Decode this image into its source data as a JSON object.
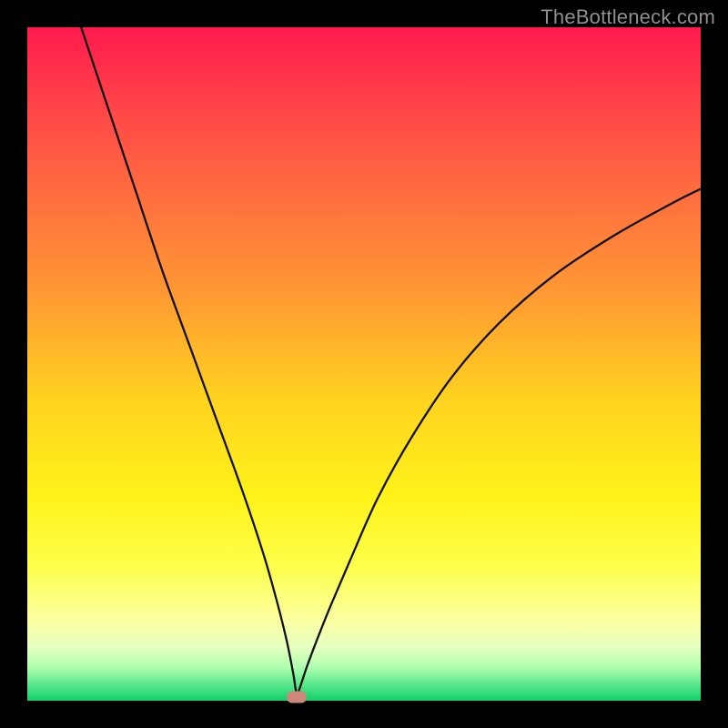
{
  "watermark": "TheBottleneck.com",
  "colors": {
    "frame": "#000000",
    "curve": "#111111",
    "marker": "#cf877c",
    "gradient_stops": [
      {
        "pos": 0.0,
        "hex": "#ff1a4d"
      },
      {
        "pos": 0.1,
        "hex": "#ff3e49"
      },
      {
        "pos": 0.25,
        "hex": "#ff6e3f"
      },
      {
        "pos": 0.4,
        "hex": "#ff9a33"
      },
      {
        "pos": 0.55,
        "hex": "#ffd21f"
      },
      {
        "pos": 0.7,
        "hex": "#fff31a"
      },
      {
        "pos": 0.8,
        "hex": "#fdff4a"
      },
      {
        "pos": 0.88,
        "hex": "#fbffa0"
      },
      {
        "pos": 0.92,
        "hex": "#e6ffc0"
      },
      {
        "pos": 0.95,
        "hex": "#b0ffb0"
      },
      {
        "pos": 0.98,
        "hex": "#4de385"
      },
      {
        "pos": 1.0,
        "hex": "#11d069"
      }
    ]
  },
  "chart_data": {
    "type": "line",
    "title": "",
    "xlabel": "",
    "ylabel": "",
    "xlim": [
      0,
      100
    ],
    "ylim": [
      0,
      100
    ],
    "min_point": {
      "x": 40,
      "y": 0
    },
    "series": [
      {
        "name": "bottleneck-curve",
        "x": [
          8,
          12,
          16,
          20,
          24,
          28,
          32,
          35,
          37,
          38.5,
          39.5,
          40,
          40.5,
          41.5,
          43,
          45,
          48,
          52,
          57,
          63,
          70,
          78,
          87,
          96,
          100
        ],
        "values": [
          100,
          88,
          76,
          64,
          53,
          42,
          31,
          22,
          15,
          9,
          4,
          1,
          2,
          5,
          9,
          14,
          21,
          30,
          39,
          48,
          56,
          63,
          69,
          74,
          76
        ]
      }
    ],
    "marker": {
      "x": 40,
      "y": 0.5
    }
  }
}
